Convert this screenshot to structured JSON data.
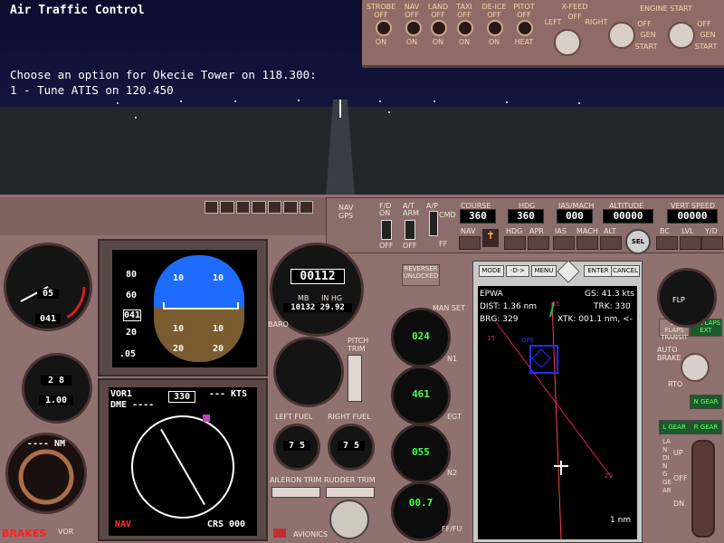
{
  "atc": {
    "title": "Air Traffic Control",
    "close": "×",
    "prompt": "Choose an option for Okecie Tower on 118.300:",
    "option1": "1 - Tune  ATIS on 120.450"
  },
  "overhead": {
    "switches": [
      {
        "name": "STROBE",
        "top": "OFF",
        "bottom": "ON"
      },
      {
        "name": "NAV",
        "top": "OFF",
        "bottom": "ON"
      },
      {
        "name": "LAND",
        "top": "OFF",
        "bottom": "ON"
      },
      {
        "name": "TAXI",
        "top": "OFF",
        "bottom": "ON"
      },
      {
        "name": "DE-ICE",
        "top": "OFF",
        "bottom": "ON"
      },
      {
        "name": "PITOT",
        "top": "OFF",
        "bottom": "HEAT"
      }
    ],
    "xfeed": {
      "label": "X-FEED",
      "off": "OFF",
      "left": "LEFT",
      "right": "RIGHT"
    },
    "engine_start": {
      "label": "ENGINE START",
      "positions": [
        "OFF",
        "GEN",
        "START"
      ]
    }
  },
  "mcp": {
    "fd": {
      "label": "F/D",
      "on": "ON",
      "off": "OFF"
    },
    "at": {
      "label": "A/T",
      "arm": "ARM",
      "off": "OFF"
    },
    "ap_label": "A/P",
    "cmd": "CMD",
    "ff": "FF",
    "course": {
      "label": "COURSE",
      "value": "360"
    },
    "hdg": {
      "label": "HDG",
      "value": "360"
    },
    "ias": {
      "label": "IAS/MACH",
      "value": "000"
    },
    "alt": {
      "label": "ALTITUDE",
      "value": "00000"
    },
    "vs": {
      "label": "VERT SPEED",
      "value": "00000"
    },
    "buttons": [
      "NAV",
      "HDG",
      "APR",
      "IAS",
      "MACH",
      "ALT",
      "SEL",
      "BC",
      "LVL",
      "Y/D"
    ],
    "nav_gps": "NAV GPS"
  },
  "altimeter": {
    "value": "00112",
    "mb": "MB",
    "inhg": "IN HG",
    "baro": "10132 29.92",
    "label": "BARO"
  },
  "speed": {
    "bug": "041",
    "mach": "05"
  },
  "attitude": {
    "pitch_labels": [
      "10",
      "10",
      "10",
      "10",
      "20",
      "20"
    ],
    "alt_tape": [
      "80",
      "60",
      "40",
      "20"
    ],
    "alt_box": "041",
    "vs": ".05"
  },
  "hsi": {
    "vor": "VOR1",
    "dme": "DME ----",
    "course": "330",
    "kts": "--- KTS",
    "nav": "NAV",
    "crs": "CRS 000"
  },
  "fuel": {
    "left": "LEFT FUEL",
    "right": "RIGHT FUEL",
    "left_val": "7 5",
    "right_val": "7 5"
  },
  "trim": {
    "pitch": "PITCH TRIM",
    "aileron": "AILERON TRIM",
    "rudder": "RUDDER TRIM",
    "avionics": "AVIONICS"
  },
  "engines": {
    "man_set": "MAN SET",
    "n1": "N1",
    "egt": "EGT",
    "n2": "N2",
    "ff": "FF/FU",
    "n1_val": "024",
    "egt_val": "461",
    "n2_val": "055",
    "ff_val": "00.7"
  },
  "gps": {
    "buttons": [
      "MODE",
      "-D->",
      "MENU",
      "ENTER",
      "CANCEL"
    ],
    "waypoint": "EPWA",
    "gs": "GS: 41.3 kts",
    "dist": "DIST: 1.36 nm",
    "trk": "TRK: 330",
    "brg": "BRG: 329",
    "xtk": "XTK: 001.1 nm, <-",
    "scale": "1 nm",
    "labels": {
      "ope": "OPE",
      "r15": "15",
      "r29": "29"
    }
  },
  "rightpanel": {
    "reverse": "REVERSER UNLOCKED",
    "flaps": "LE FLAPS TRANSIT",
    "flaps_ext": "LE FLAPS EXT",
    "autobrake": "AUTO BRAKE",
    "rto": "RTO",
    "ngear": "N GEAR",
    "lgear": "L GEAR",
    "rgear": "R GEAR",
    "landing_gear": "LANDING GEAR",
    "up": "UP",
    "off": "OFF",
    "dn": "DN",
    "flp": "FLP"
  },
  "standby": {
    "nm": "---- NM",
    "vor": "VOR"
  },
  "clock": {
    "value": "1.00",
    "n2": "2 8"
  },
  "alt_display": {
    "top": "05",
    "bottom": "041"
  },
  "status": {
    "brakes": "BRAKES"
  }
}
